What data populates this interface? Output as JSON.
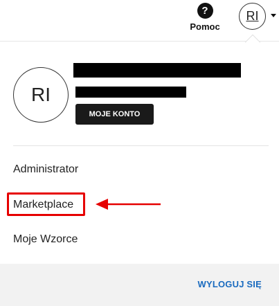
{
  "header": {
    "help_icon_glyph": "?",
    "help_label": "Pomoc",
    "user_initials": "RI"
  },
  "profile": {
    "initials": "RI",
    "account_button": "MOJE KONTO"
  },
  "menu": {
    "items": [
      {
        "label": "Administrator"
      },
      {
        "label": "Marketplace"
      },
      {
        "label": "Moje Wzorce"
      }
    ]
  },
  "footer": {
    "logout_label": "WYLOGUJ SIĘ"
  },
  "colors": {
    "annotation_red": "#e60000",
    "logout_blue": "#1a6bbf"
  },
  "icons": {
    "help": "help-circle-icon",
    "dropdown": "caret-down-icon",
    "annotation_arrow": "arrow-left-icon"
  }
}
